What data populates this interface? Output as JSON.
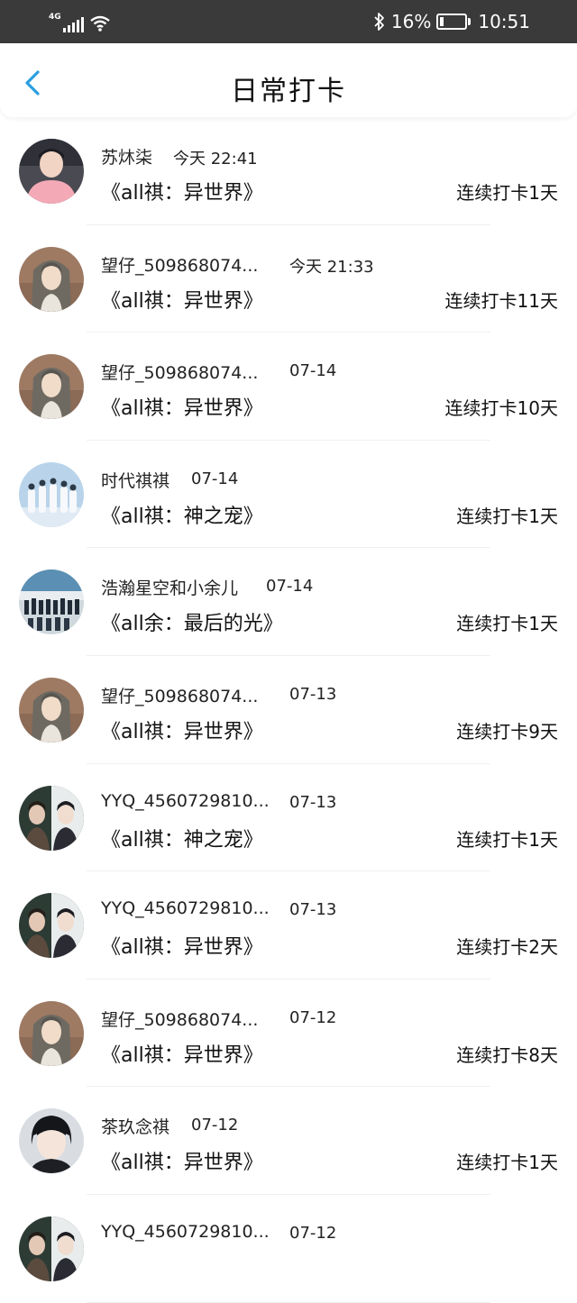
{
  "status_bar": {
    "network": "4G",
    "battery_percent": "16%",
    "battery_level": 0.16,
    "time": "10:51"
  },
  "header": {
    "title": "日常打卡"
  },
  "checkins": [
    {
      "name": "苏炑柒",
      "time": "今天 22:41",
      "book": "《all祺：异世界》",
      "streak": "连续打卡1天",
      "avatar": "avatar-pink-shirt"
    },
    {
      "name": "望仔_509868074...",
      "time": "今天 21:33",
      "book": "《all祺：异世界》",
      "streak": "连续打卡11天",
      "avatar": "avatar-anime-longhair"
    },
    {
      "name": "望仔_509868074...",
      "time": "07-14",
      "book": "《all祺：异世界》",
      "streak": "连续打卡10天",
      "avatar": "avatar-anime-longhair"
    },
    {
      "name": "时代祺祺",
      "time": "07-14",
      "book": "《all祺：神之宠》",
      "streak": "连续打卡1天",
      "avatar": "avatar-group-white"
    },
    {
      "name": "浩瀚星空和小余儿",
      "time": "07-14",
      "book": "《all余：最后的光》",
      "streak": "连续打卡1天",
      "avatar": "avatar-group-stage"
    },
    {
      "name": "望仔_509868074...",
      "time": "07-13",
      "book": "《all祺：异世界》",
      "streak": "连续打卡9天",
      "avatar": "avatar-anime-longhair"
    },
    {
      "name": "YYQ_4560729810...",
      "time": "07-13",
      "book": "《all祺：神之宠》",
      "streak": "连续打卡1天",
      "avatar": "avatar-two-anime"
    },
    {
      "name": "YYQ_4560729810...",
      "time": "07-13",
      "book": "《all祺：异世界》",
      "streak": "连续打卡2天",
      "avatar": "avatar-two-anime"
    },
    {
      "name": "望仔_509868074...",
      "time": "07-12",
      "book": "《all祺：异世界》",
      "streak": "连续打卡8天",
      "avatar": "avatar-anime-longhair"
    },
    {
      "name": "茶玖念祺",
      "time": "07-12",
      "book": "《all祺：异世界》",
      "streak": "连续打卡1天",
      "avatar": "avatar-boy-portrait"
    },
    {
      "name": "YYQ_4560729810...",
      "time": "07-12",
      "book": "",
      "streak": "",
      "avatar": "avatar-two-anime"
    }
  ]
}
